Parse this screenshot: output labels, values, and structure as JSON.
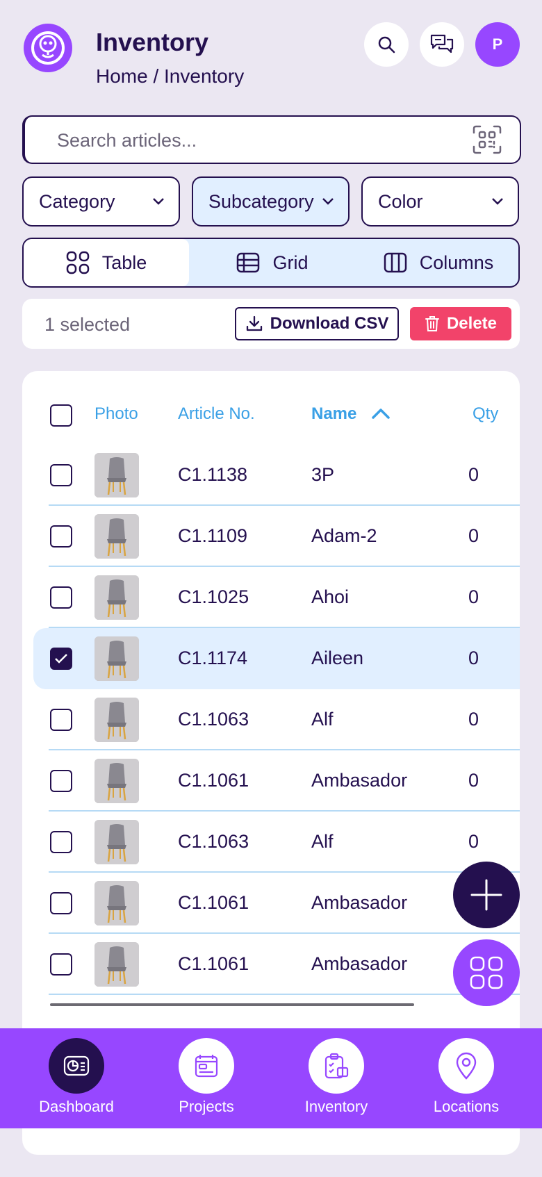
{
  "header": {
    "title": "Inventory",
    "breadcrumb": "Home / Inventory",
    "avatar_initial": "P"
  },
  "search": {
    "placeholder": "Search articles...",
    "value": ""
  },
  "filters": [
    {
      "label": "Category"
    },
    {
      "label": "Subcategory"
    },
    {
      "label": "Color"
    }
  ],
  "views": [
    {
      "label": "Table",
      "active": true
    },
    {
      "label": "Grid",
      "active": false
    },
    {
      "label": "Columns",
      "active": false
    }
  ],
  "selection": {
    "count_text": "1 selected",
    "download_label": "Download CSV",
    "delete_label": "Delete"
  },
  "table": {
    "columns": [
      "Photo",
      "Article No.",
      "Name",
      "Qty"
    ],
    "sorted_column": "Name",
    "sort_direction": "ascending",
    "rows": [
      {
        "article": "C1.1138",
        "name": "3P",
        "qty": "0",
        "checked": false
      },
      {
        "article": "C1.1109",
        "name": "Adam-2",
        "qty": "0",
        "checked": false
      },
      {
        "article": "C1.1025",
        "name": "Ahoi",
        "qty": "0",
        "checked": false
      },
      {
        "article": "C1.1174",
        "name": "Aileen",
        "qty": "0",
        "checked": true
      },
      {
        "article": "C1.1063",
        "name": "Alf",
        "qty": "0",
        "checked": false
      },
      {
        "article": "C1.1061",
        "name": "Ambasador",
        "qty": "0",
        "checked": false
      },
      {
        "article": "C1.1063",
        "name": "Alf",
        "qty": "0",
        "checked": false
      },
      {
        "article": "C1.1061",
        "name": "Ambasador",
        "qty": "",
        "checked": false
      },
      {
        "article": "C1.1061",
        "name": "Ambasador",
        "qty": "",
        "checked": false
      }
    ]
  },
  "bottom_nav": [
    {
      "label": "Dashboard",
      "icon": "dashboard-icon",
      "active": true
    },
    {
      "label": "Projects",
      "icon": "projects-icon",
      "active": false
    },
    {
      "label": "Inventory",
      "icon": "inventory-icon",
      "active": false
    },
    {
      "label": "Locations",
      "icon": "location-pin-icon",
      "active": false
    }
  ],
  "colors": {
    "primary_dark": "#24104f",
    "accent_purple": "#9747ff",
    "header_blue": "#3aa0e6",
    "delete_red": "#f2436a",
    "selected_row": "#e1efff",
    "background": "#ebe7f2"
  }
}
